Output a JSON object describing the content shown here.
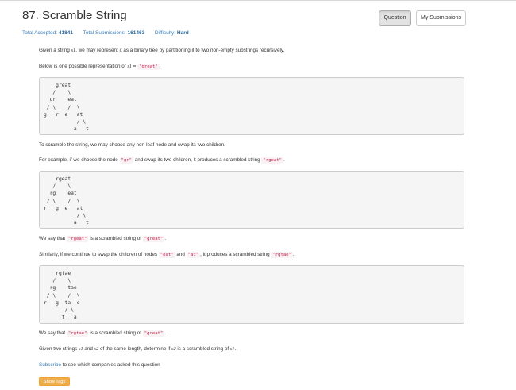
{
  "header": {
    "title": "87. Scramble String",
    "question_button": "Question",
    "submissions_button": "My Submissions"
  },
  "stats": {
    "accepted_label": "Total Accepted:",
    "accepted_value": "41841",
    "submissions_label": "Total Submissions:",
    "submissions_value": "161463",
    "difficulty_label": "Difficulty:",
    "difficulty_value": "Hard"
  },
  "content": {
    "p1_a": "Given a string ",
    "p1_var": "s1",
    "p1_b": ", we may represent it as a binary tree by partitioning it to two non-empty substrings recursively.",
    "p2_a": "Below is one possible representation of ",
    "p2_var": "s1",
    "p2_b": " = ",
    "p2_code": "\"great\"",
    "p2_c": ":",
    "tree1": "    great\n   /    \\\n  gr    eat\n / \\    /  \\\ng   r  e   at\n           / \\\n          a   t",
    "p3": "To scramble the string, we may choose any non-leaf node and swap its two children.",
    "p4_a": "For example, if we choose the node ",
    "p4_code1": "\"gr\"",
    "p4_b": " and swap its two children, it produces a scrambled string ",
    "p4_code2": "\"rgeat\"",
    "p4_c": ".",
    "tree2": "    rgeat\n   /    \\\n  rg    eat\n / \\    /  \\\nr   g  e   at\n           / \\\n          a   t",
    "p5_a": "We say that ",
    "p5_code1": "\"rgeat\"",
    "p5_b": " is a scrambled string of ",
    "p5_code2": "\"great\"",
    "p5_c": ".",
    "p6_a": "Similarly, if we continue to swap the children of nodes ",
    "p6_code1": "\"eat\"",
    "p6_b": " and ",
    "p6_code2": "\"at\"",
    "p6_c": ", it produces a scrambled string ",
    "p6_code3": "\"rgtae\"",
    "p6_d": ".",
    "tree3": "    rgtae\n   /    \\\n  rg    tae\n / \\    /  \\\nr   g  ta  e\n       / \\\n      t   a",
    "p7_a": "We say that ",
    "p7_code1": "\"rgtae\"",
    "p7_b": " is a scrambled string of ",
    "p7_code2": "\"great\"",
    "p7_c": ".",
    "p8_a": "Given two strings ",
    "p8_var1": "s1",
    "p8_b": " and ",
    "p8_var2": "s2",
    "p8_c": " of the same length, determine if ",
    "p8_var3": "s2",
    "p8_d": " is a scrambled string of ",
    "p8_var4": "s1",
    "p8_e": ".",
    "subscribe_link": "Subscribe",
    "subscribe_rest": " to see which companies asked this question",
    "show_tags": "Show Tags"
  }
}
